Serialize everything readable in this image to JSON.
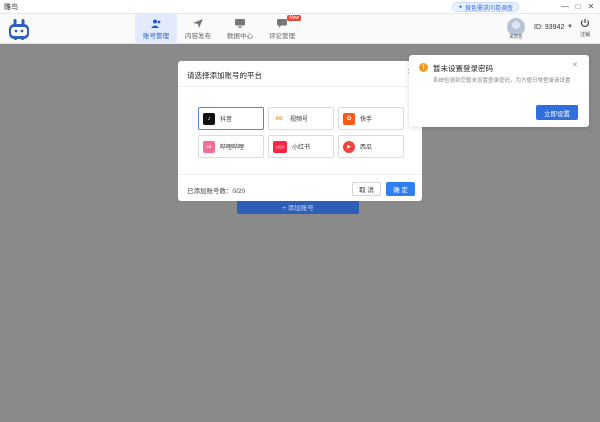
{
  "window": {
    "title": "雕鸟",
    "survey_label": "搜色需求问卷调查",
    "controls": [
      "—",
      "□",
      "✕"
    ]
  },
  "nav": {
    "items": [
      {
        "label": "账号管理",
        "icon": "users-icon",
        "active": true
      },
      {
        "label": "内容发布",
        "icon": "send-icon",
        "active": false
      },
      {
        "label": "数据中心",
        "icon": "monitor-icon",
        "active": false
      },
      {
        "label": "评论管理",
        "icon": "comment-icon",
        "active": false,
        "badge": "New"
      }
    ]
  },
  "user": {
    "id_text": "ID: 93942",
    "tag": "未实名",
    "logout_label": "注销"
  },
  "main": {
    "add_button_label": "+ 添加账号"
  },
  "dialog": {
    "title": "请选择添加账号的平台",
    "platforms": [
      {
        "label": "抖音",
        "icon": "douyin-icon",
        "color": "#111111",
        "glyph": "♪",
        "selected": true
      },
      {
        "label": "视频号",
        "icon": "channels-icon",
        "color": "#f3a21f",
        "glyph": "∞",
        "selected": false
      },
      {
        "label": "快手",
        "icon": "kuaishou-icon",
        "color": "#ff5a1e",
        "glyph": "✿",
        "selected": false
      },
      {
        "label": "哔哩哔哩",
        "icon": "bilibili-icon",
        "color": "#f06f96",
        "glyph": "bili",
        "selected": false
      },
      {
        "label": "小红书",
        "icon": "xiaohongshu-icon",
        "color": "#ff2442",
        "glyph": "小红书",
        "selected": false
      },
      {
        "label": "西瓜",
        "icon": "xigua-icon",
        "color": "#f4433c",
        "glyph": "▶",
        "selected": false
      }
    ],
    "count_text": "已添加账号数：0/20",
    "cancel_label": "取 消",
    "ok_label": "确 定"
  },
  "notice": {
    "title": "暂未设置登录密码",
    "body": "系统检测到您暂未设置登录密码，为方便日常登录请设置",
    "button_label": "立即设置"
  },
  "colors": {
    "accent": "#2f7ef5",
    "nav_active_bg": "#e3eafc",
    "overlay": "#8a8a8a",
    "warning": "#f29d26"
  }
}
